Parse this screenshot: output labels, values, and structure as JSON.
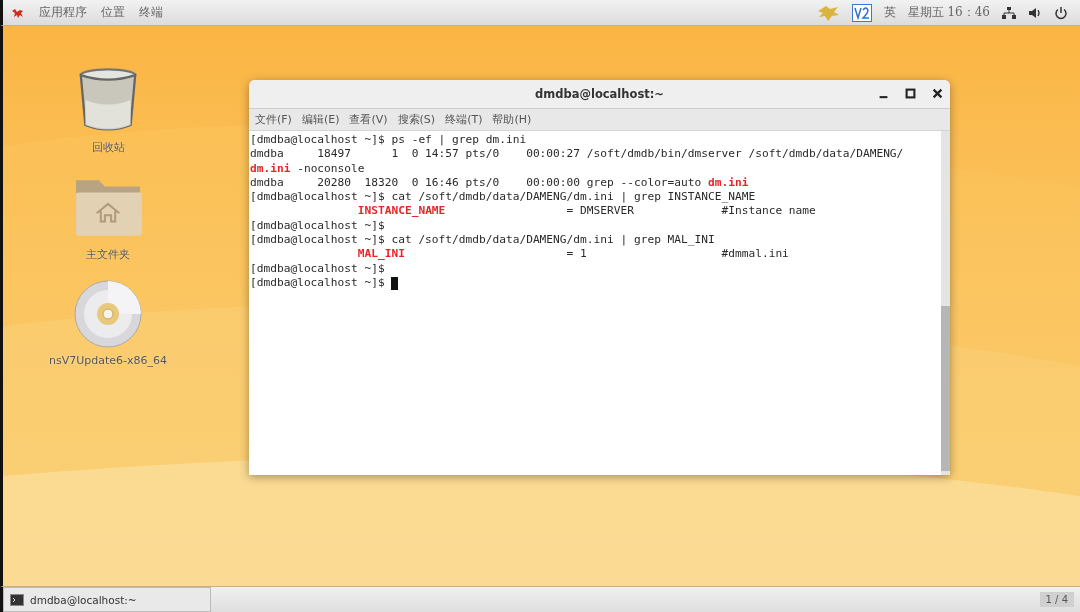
{
  "top_bar": {
    "menus": [
      {
        "label": "应用程序"
      },
      {
        "label": "位置"
      },
      {
        "label": "终端"
      }
    ],
    "input_method": "英",
    "clock": "星期五 16：46"
  },
  "desktop": {
    "icons": [
      {
        "kind": "trash",
        "label": "回收站"
      },
      {
        "kind": "home-folder",
        "label": "主文件夹"
      },
      {
        "kind": "disc",
        "label": "nsV7Update6-x86_64"
      }
    ]
  },
  "terminal_window": {
    "title": "dmdba@localhost:~",
    "menu": [
      {
        "label": "文件(F)"
      },
      {
        "label": "编辑(E)"
      },
      {
        "label": "查看(V)"
      },
      {
        "label": "搜索(S)"
      },
      {
        "label": "终端(T)"
      },
      {
        "label": "帮助(H)"
      }
    ],
    "lines": [
      {
        "text": "[dmdba@localhost ~]$ ps -ef | grep dm.ini",
        "cursor": false
      },
      {
        "text": "dmdba     18497      1  0 14:57 pts/0    00:00:27 /soft/dmdb/bin/dmserver /soft/dmdb/data/DAMENG/",
        "cursor": false
      },
      {
        "text": "**dm.ini** -noconsole",
        "cursor": false
      },
      {
        "text": "dmdba     20280  18320  0 16:46 pts/0    00:00:00 grep --color=auto **dm.ini**",
        "cursor": false
      },
      {
        "text": "[dmdba@localhost ~]$ cat /soft/dmdb/data/DAMENG/dm.ini | grep INSTANCE_NAME",
        "cursor": false
      },
      {
        "text": "                **INSTANCE_NAME**                  = DMSERVER             #Instance name",
        "cursor": false
      },
      {
        "text": "[dmdba@localhost ~]$",
        "cursor": false
      },
      {
        "text": "[dmdba@localhost ~]$ cat /soft/dmdb/data/DAMENG/dm.ini | grep MAL_INI",
        "cursor": false
      },
      {
        "text": "                **MAL_INI**                        = 1                    #dmmal.ini",
        "cursor": false
      },
      {
        "text": "[dmdba@localhost ~]$",
        "cursor": false
      },
      {
        "text": "[dmdba@localhost ~]$ ",
        "cursor": true
      }
    ]
  },
  "taskbar": {
    "tasks": [
      {
        "label": "dmdba@localhost:~"
      }
    ],
    "workspace": "1 / 4"
  }
}
